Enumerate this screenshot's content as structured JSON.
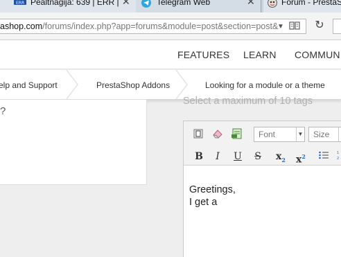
{
  "browser": {
    "tabs": [
      {
        "label": "Pealtnägija: 639 | ERR |",
        "close": "✕"
      },
      {
        "label": "Telegram Web",
        "close": "✕"
      },
      {
        "label": "Forum - PrestaS",
        "close": ""
      }
    ],
    "url": {
      "host": "ashop.com",
      "path": "/forums/index.php?app=forums&module=post&section=post&"
    }
  },
  "site_nav": {
    "items": [
      "FEATURES",
      "LEARN",
      "COMMUNIT"
    ]
  },
  "breadcrumb": {
    "items": [
      "elp and Support",
      "PrestaShop Addons",
      "Looking for a module or a theme"
    ]
  },
  "left_card": {
    "text": "?"
  },
  "tags": {
    "hint": "Select a maximum of 10 tags"
  },
  "editor": {
    "font_select": "Font",
    "size_select": "Size",
    "toolbar": {
      "bold": "B",
      "italic": "I",
      "underline": "U",
      "strike": "S",
      "subscript": "x",
      "subscript_mark": "2",
      "superscript": "x",
      "superscript_mark": "2"
    },
    "content_lines": [
      "Greetings,",
      "I get a"
    ]
  },
  "colors": {
    "tab_bg": "#c9d3de",
    "telegram_blue": "#2ea6da",
    "editor_border": "#c9c9c9",
    "hint_gray": "#b0b0b0"
  },
  "icons": [
    "err-favicon-icon",
    "telegram-icon",
    "prestashop-favicon-icon",
    "dropdown-arrow-icon",
    "reader-view-icon",
    "reload-icon",
    "source-icon",
    "eraser-icon",
    "image-icon",
    "bullet-list-icon",
    "numbered-list-icon"
  ]
}
